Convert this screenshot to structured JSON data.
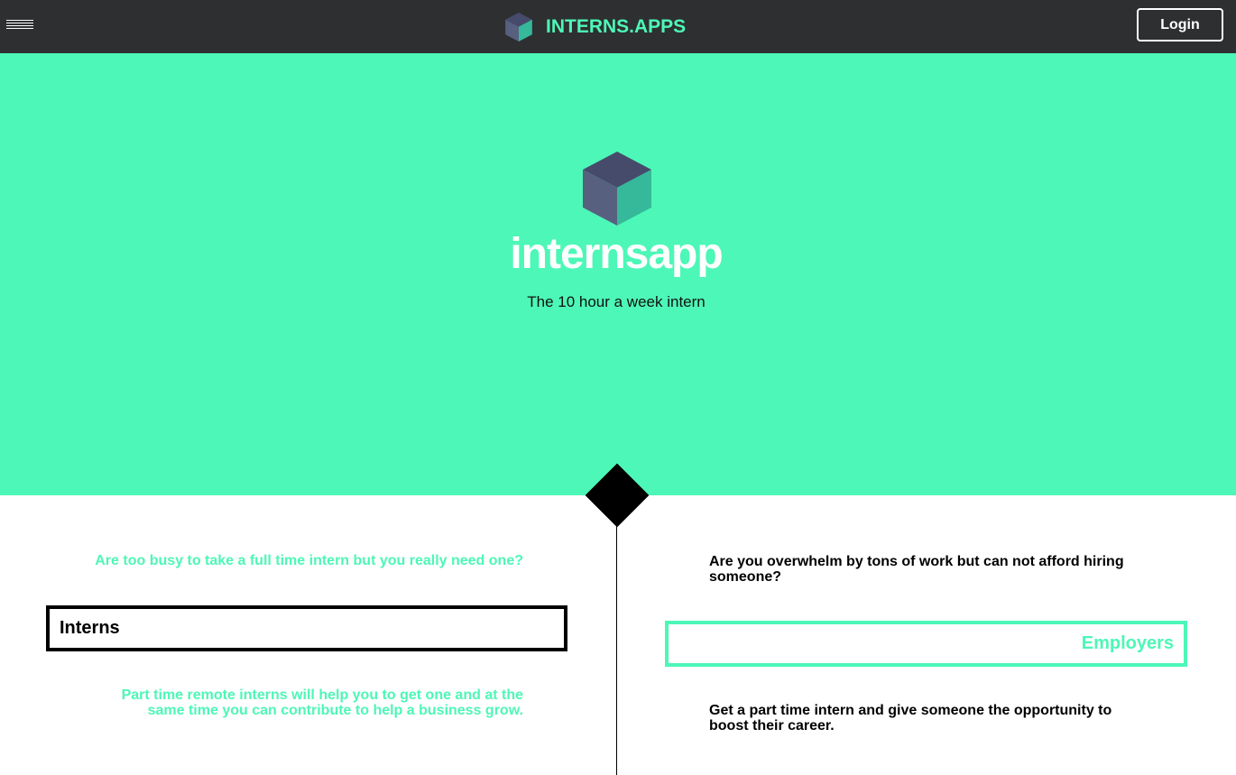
{
  "header": {
    "brand_name": "INTERNS.APPS",
    "login_label": "Login"
  },
  "hero": {
    "title": "internsapp",
    "subtitle": "The 10 hour a week intern"
  },
  "interns": {
    "question": "Are too busy to take a full time intern but you really need one?",
    "button_label": "Interns",
    "description": "Part time remote interns will help you to get one and at the same time you can contribute to help a business grow."
  },
  "employers": {
    "question": "Are you overwhelm by tons of work but can not afford hiring someone?",
    "button_label": "Employers",
    "description": "Get a part time intern and give someone the opportunity to boost their career."
  },
  "colors": {
    "accent": "#4df7b7",
    "header_bg": "#2e2f31",
    "cube_top": "#464b6b",
    "cube_left": "#586080",
    "cube_right": "#35b99a"
  }
}
